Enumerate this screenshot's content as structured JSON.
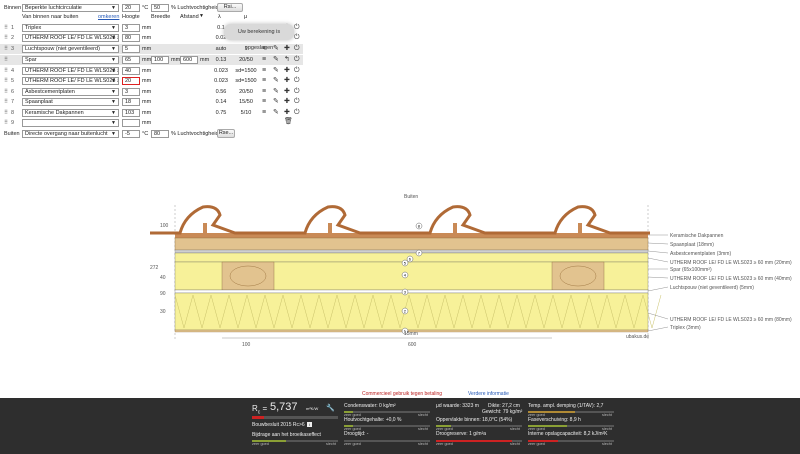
{
  "binnen": {
    "label": "Binnen",
    "climate": "Beperkte luchtcirculatie",
    "temp": "20",
    "temp_unit": "°C",
    "rh": "50",
    "rh_label": "% Luchtvochtigheid",
    "button": "Rsi..."
  },
  "header": {
    "order": "Van binnen naar buiten",
    "reverse_link": "omkeren",
    "hoogte": "Hoogte",
    "breedte": "Breedte",
    "afstand": "Afstand",
    "lambda": "λ",
    "mu": "μ"
  },
  "layers": [
    {
      "n": "1",
      "name": "Triplex",
      "h": "3",
      "unit": "mm",
      "lambda": "0.1",
      "mu": ""
    },
    {
      "n": "2",
      "name": "UTHERM ROOF LE/ FD LE WLS023 ≥ 60",
      "h": "80",
      "unit": "mm",
      "lambda": "0.02",
      "mu": ""
    },
    {
      "n": "3",
      "name": "Luchtspouw (niet geventileerd)",
      "h": "5",
      "unit": "mm",
      "lambda": "auto",
      "mu": "1"
    },
    {
      "n": "",
      "name": "Spar",
      "h": "65",
      "unit": "mm",
      "w": "100",
      "wunit": "mm",
      "d": "600",
      "dunit": "mm",
      "lambda": "0.13",
      "mu": "20/50"
    },
    {
      "n": "4",
      "name": "UTHERM ROOF LE/ FD LE WLS023 ≥",
      "h": "40",
      "unit": "mm",
      "lambda": "0.023",
      "mu": "sd=1500"
    },
    {
      "n": "5",
      "name": "UTHERM ROOF LE/ FD LE WLS023 ≥",
      "h": "20",
      "unit": "mm",
      "lambda": "0.023",
      "mu": "sd=1500"
    },
    {
      "n": "6",
      "name": "Asbestcementplaten",
      "h": "3",
      "unit": "mm",
      "lambda": "0.56",
      "mu": "20/50"
    },
    {
      "n": "7",
      "name": "Spaanplaat",
      "h": "18",
      "unit": "mm",
      "lambda": "0.14",
      "mu": "15/50"
    },
    {
      "n": "8",
      "name": "Keramische Dakpannen",
      "h": "103",
      "unit": "mm",
      "lambda": "0.75",
      "mu": "5/10"
    },
    {
      "n": "9",
      "name": "",
      "h": "",
      "unit": "mm",
      "lambda": "",
      "mu": ""
    }
  ],
  "buiten": {
    "label": "Buiten",
    "climate": "Directe overgang naar buitenlucht",
    "temp": "-5",
    "temp_unit": "°C",
    "rh": "80",
    "rh_label": "% Luchtvochtigheid",
    "button": "Rse..."
  },
  "tooltip": "Uw berekening is opgeslagen",
  "diagram": {
    "top_label": "Buiten",
    "left_ticks": [
      "100",
      "272",
      "40",
      "30",
      "90"
    ],
    "bottom_dims": [
      "100",
      "600"
    ],
    "mm_label": "15mm",
    "watermark": "ubakus.de",
    "labels": [
      "Keramische Dakpannen",
      "Spaanplaat (18mm)",
      "Asbestcementplaten (3mm)",
      "UTHERM ROOF LE/ FD LE WLS023 ≥ 60 mm (20mm)",
      "Spar (65x100mm²)",
      "UTHERM ROOF LE/ FD LE WLS023 ≥ 60 mm (40mm)",
      "Luchtspouw (niet geventileerd) (5mm)",
      "UTHERM ROOF LE/ FD LE WLS023 ≥ 60 mm (80mm)",
      "Triplex (3mm)"
    ],
    "markers": [
      "8",
      "7",
      "6",
      "5",
      "4",
      "3",
      "2",
      "1"
    ]
  },
  "footer": {
    "commercial": "Commercieel gebruik tegen betaling",
    "more_info": "Verdere informatie"
  },
  "results": {
    "rc_label": "R",
    "rc_sub": "c",
    "rc_eq": "=",
    "rc_value": "5,737",
    "rc_unit": "m²K/W",
    "bouwbesluit": "Bouwbesluit 2015 Rc>6",
    "bijdrage": "Bijdrage aan het broeikaseffect",
    "condens": "Condenswater: 0 kg/m²",
    "houtvocht": "Houtvochtgehalte: +0,0 %",
    "droogtijd": "Droogtijd: -",
    "sd": "μd waarde: 3323 m",
    "dikte": "Dikte: 27,2 cm",
    "gewicht": "Gewicht: 79 kg/m²",
    "opp": "Oppervlakte binnen: 18,0°C (54%)",
    "droog": "Droogreserve: 1 g/m²a",
    "temp_amp": "Temp. ampl. demping (1/TAV): 2,7",
    "fase": "Faseverschuiving: 8,9 h",
    "warmte": "Interne opslagcapaciteit: 8,2 kJ/m²K",
    "zeer_goed": "zeer goed",
    "slecht": "slecht"
  },
  "colors": {
    "insulation": "#f7f199",
    "wood": "#e2c38f",
    "tile": "#c98a56",
    "dark": "#2e2e2e",
    "bar_green": "#8a9f35",
    "bar_red": "#c22"
  }
}
